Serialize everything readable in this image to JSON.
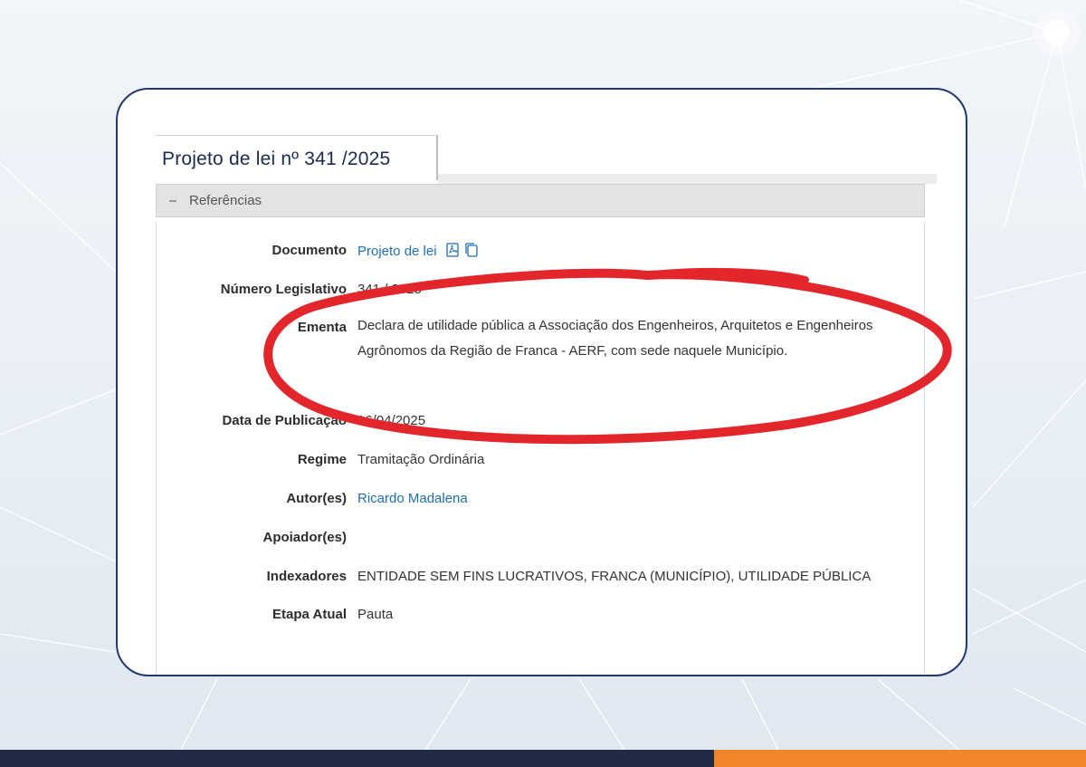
{
  "tab": {
    "title": "Projeto de lei nº 341 /2025"
  },
  "section": {
    "label": "Referências"
  },
  "fields": {
    "documento": {
      "label": "Documento",
      "value": "Projeto de lei",
      "icons": [
        "pdf-icon",
        "copy-icon"
      ]
    },
    "numero": {
      "label": "Número Legislativo",
      "value": "341 / 2025"
    },
    "ementa": {
      "label": "Ementa",
      "value": "Declara de utilidade pública a Associação dos Engenheiros, Arquitetos e Engenheiros Agrônomos da Região de Franca - AERF, com sede naquele Município."
    },
    "data": {
      "label": "Data de Publicação",
      "value": "16/04/2025"
    },
    "regime": {
      "label": "Regime",
      "value": "Tramitação Ordinária"
    },
    "autor": {
      "label": "Autor(es)",
      "value": "Ricardo Madalena"
    },
    "apoiador": {
      "label": "Apoiador(es)",
      "value": ""
    },
    "indexadores": {
      "label": "Indexadores",
      "value": "ENTIDADE SEM FINS LUCRATIVOS, FRANCA (MUNICÍPIO), UTILIDADE PÚBLICA"
    },
    "etapa": {
      "label": "Etapa Atual",
      "value": "Pauta"
    }
  },
  "colors": {
    "card_border": "#1e3a70",
    "highlight": "#e3262b",
    "link": "#1f6fb0",
    "footer_navy": "#222b45",
    "footer_orange": "#f0852b"
  }
}
